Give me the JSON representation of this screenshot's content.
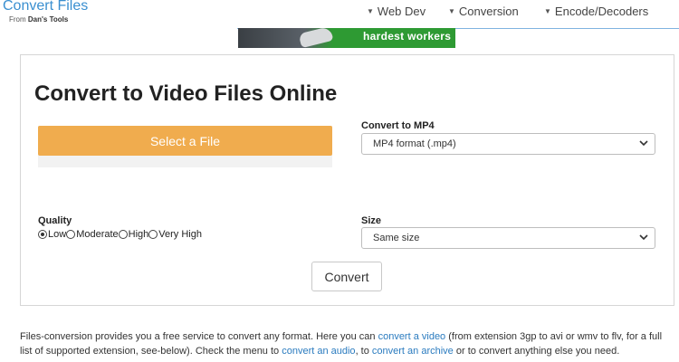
{
  "header": {
    "logo_title": "Convert Files",
    "logo_sub_prefix": "From ",
    "logo_sub_brand": "Dan's Tools",
    "nav": [
      {
        "label": "Web Dev"
      },
      {
        "label": "Conversion"
      },
      {
        "label": "Encode/Decoders"
      }
    ]
  },
  "ad": {
    "text": "hardest workers",
    "icon": "shoe-image"
  },
  "main": {
    "title": "Convert to Video Files Online",
    "select_file_label": "Select a File",
    "convert_to_label": "Convert to MP4",
    "format_selected": "MP4 format (.mp4)",
    "quality_label": "Quality",
    "quality_options": [
      "Low",
      "Moderate",
      "High",
      "Very High"
    ],
    "quality_selected": "Low",
    "size_label": "Size",
    "size_selected": "Same size",
    "convert_button": "Convert"
  },
  "description": {
    "p1": "Files-conversion provides you a free service to convert any format. Here you can ",
    "link1": "convert a video",
    "p2": " (from extension 3gp to avi or wmv to flv, for a full list of supported extension, see-below). Check the menu to ",
    "link2": "convert an audio",
    "p3": ", to ",
    "link3": "convert an archive",
    "p4": " or to convert anything else you need."
  },
  "colors": {
    "accent_orange": "#f0ac4e",
    "link_blue": "#2a7bbf",
    "logo_blue": "#3a8fd0",
    "ad_green": "#2e9a33"
  }
}
